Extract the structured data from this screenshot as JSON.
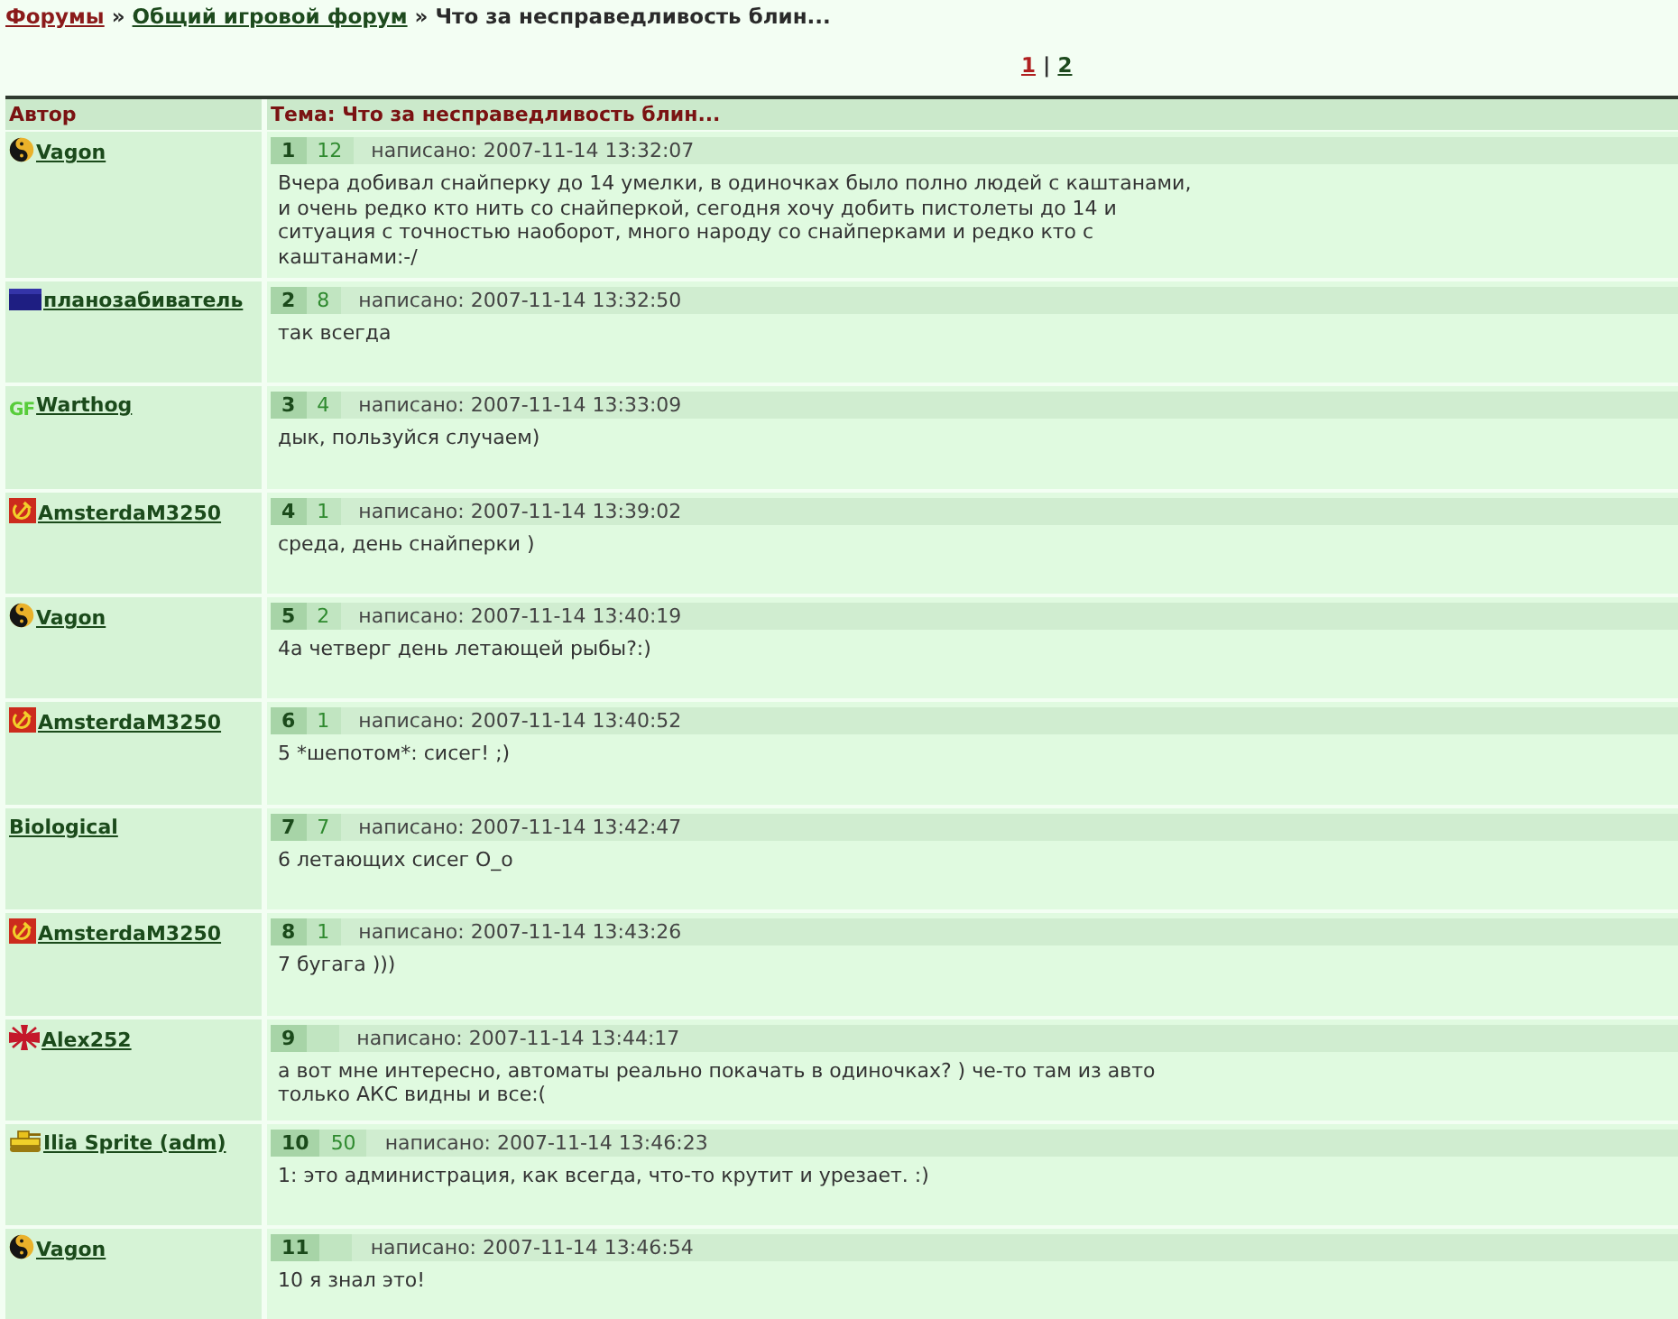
{
  "breadcrumbs": [
    {
      "kind": "root",
      "label": "Форумы"
    },
    {
      "kind": "separator",
      "label": "»"
    },
    {
      "kind": "link",
      "label": "Общий игровой форум"
    },
    {
      "kind": "separator",
      "label": "»"
    },
    {
      "kind": "current",
      "label": "Что за несправедливость блин..."
    }
  ],
  "pagination": {
    "pages": [
      {
        "label": "1",
        "selected": true
      },
      {
        "label": "2",
        "selected": false
      }
    ],
    "separator": "|"
  },
  "table": {
    "columns": [
      "Автор",
      "Тема: Что за несправедливость блин..."
    ],
    "posts": [
      {
        "author": "Vagon",
        "avatar": {
          "kind": "yin-yang"
        },
        "number": "1",
        "count": "12",
        "posted": "написано: 2007-11-14 13:32:07",
        "text": "Вчера добивал снайперку до 14 умелки, в одиночках было полно людей с каштанами,\nи очень редко кто нить со снайперкой, сегодня хочу добить пистолеты до 14 и\nситуация с точностью наоборот, много народу со снайперками и редко кто с\nкаштанами:-/"
      },
      {
        "author": "планозабиватель",
        "avatar": {
          "kind": "flag"
        },
        "number": "2",
        "count": "8",
        "posted": "написано: 2007-11-14 13:32:50",
        "text": "так всегда"
      },
      {
        "author": "Warthog",
        "avatar": {
          "kind": "letters",
          "text": "GF"
        },
        "number": "3",
        "count": "4",
        "posted": "написано: 2007-11-14 13:33:09",
        "text": "дык, пользуйся случаем)"
      },
      {
        "author": "AmsterdaM3250",
        "avatar": {
          "kind": "hammer-sickle"
        },
        "number": "4",
        "count": "1",
        "posted": "написано: 2007-11-14 13:39:02",
        "text": "среда, день снайперки )"
      },
      {
        "author": "Vagon",
        "avatar": {
          "kind": "yin-yang"
        },
        "number": "5",
        "count": "2",
        "posted": "написано: 2007-11-14 13:40:19",
        "text": "4а четверг день летающей рыбы?:)"
      },
      {
        "author": "AmsterdaM3250",
        "avatar": {
          "kind": "hammer-sickle"
        },
        "number": "6",
        "count": "1",
        "posted": "написано: 2007-11-14 13:40:52",
        "text": "5 *шепотом*: сисег! ;)"
      },
      {
        "author": "Biological",
        "number": "7",
        "count": "7",
        "posted": "написано: 2007-11-14 13:42:47",
        "text": "6 летающих сисег О_о"
      },
      {
        "author": "AmsterdaM3250",
        "avatar": {
          "kind": "hammer-sickle"
        },
        "number": "8",
        "count": "1",
        "posted": "написано: 2007-11-14 13:43:26",
        "text": "7 бугага )))"
      },
      {
        "author": "Alex252",
        "avatar": {
          "kind": "cross"
        },
        "number": "9",
        "posted": "написано: 2007-11-14 13:44:17",
        "text": "а вот мне интересно, автоматы реально покачать в одиночках? ) че-то там из авто\nтолько АКС видны и все:("
      },
      {
        "author": "Ilia Sprite (adm)",
        "avatar": {
          "kind": "tank"
        },
        "number": "10",
        "count": "50",
        "posted": "написано: 2007-11-14 13:46:23",
        "text": "1: это администрация, как всегда, что-то крутит и урезает. :)"
      },
      {
        "author": "Vagon",
        "avatar": {
          "kind": "yin-yang"
        },
        "number": "11",
        "posted": "написано: 2007-11-14 13:46:54",
        "text": "10 я знал это!"
      }
    ]
  }
}
